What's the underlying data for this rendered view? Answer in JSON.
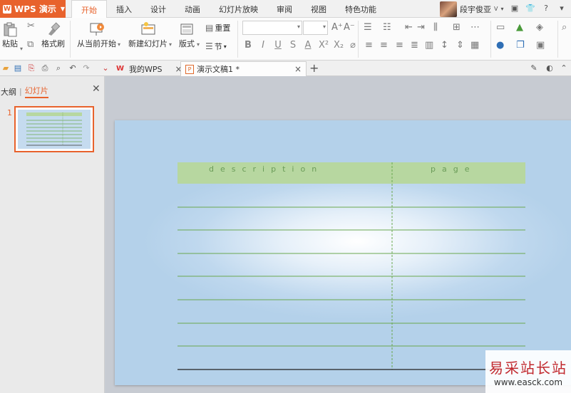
{
  "app": {
    "menu_label": "WPS 演示"
  },
  "ribbon_tabs": [
    "开始",
    "插入",
    "设计",
    "动画",
    "幻灯片放映",
    "审阅",
    "视图",
    "特色功能"
  ],
  "user": {
    "name": "段宇俊亚"
  },
  "ribbon": {
    "paste": "粘贴",
    "format_painter": "格式刷",
    "from_current": "从当前开始",
    "new_slide": "新建幻灯片",
    "layout": "版式",
    "reset": "重置",
    "section": "节"
  },
  "doc_tabs": [
    {
      "label": "我的WPS",
      "active": false
    },
    {
      "label": "演示文稿1 *",
      "active": true
    }
  ],
  "left_panel": {
    "tab_outline": "大纲",
    "tab_slides": "幻灯片",
    "slide_number": "1"
  },
  "slide": {
    "col1_title": "description",
    "col2_title": "page",
    "header_color": "#b7d7a0",
    "line_color": "#6aa84f"
  },
  "watermark": {
    "text_cn": "易采站长站",
    "url": "www.easck.com"
  },
  "colors": {
    "accent": "#e8622c"
  }
}
